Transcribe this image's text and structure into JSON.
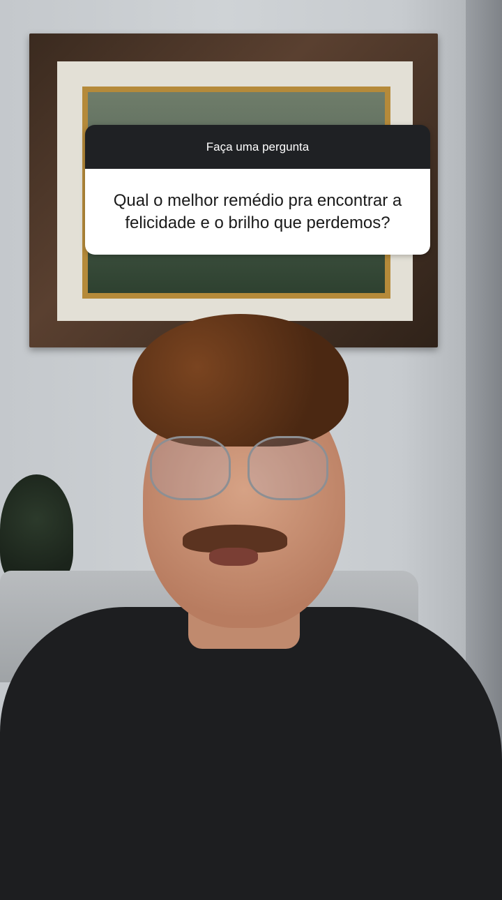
{
  "question_sticker": {
    "header": "Faça uma pergunta",
    "question": "Qual o melhor remédio pra encontrar a felicidade e o brilho que perdemos?"
  },
  "colors": {
    "sticker_header_bg": "#1f2124",
    "sticker_body_bg": "#ffffff"
  }
}
